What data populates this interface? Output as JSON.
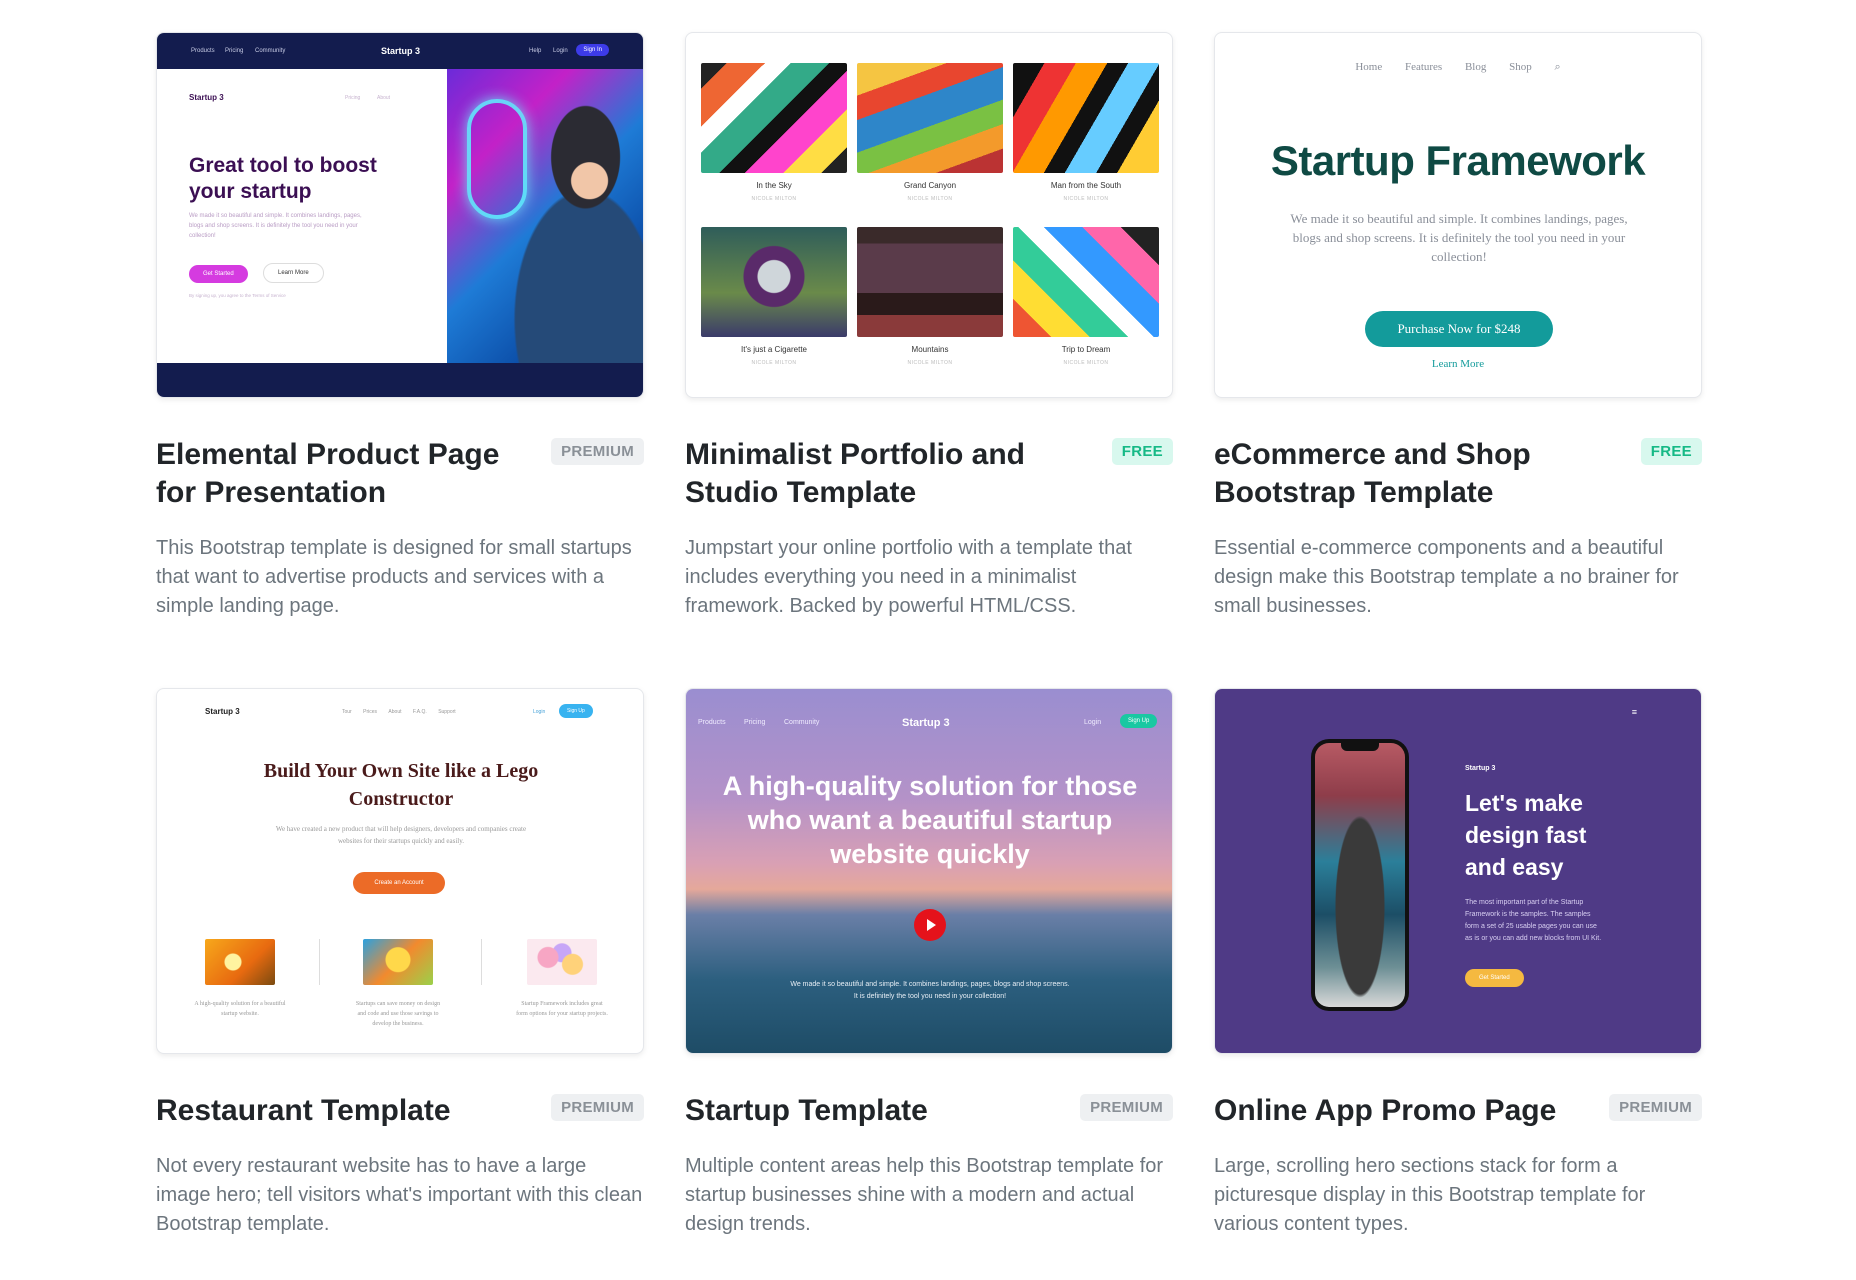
{
  "cards": [
    {
      "title": "Elemental Product Page for Presentation",
      "badge": "PREMIUM",
      "description": "This Bootstrap template is designed for small startups that want to advertise products and services with a simple landing page.",
      "thumb": {
        "nav": [
          "Products",
          "Pricing",
          "Community"
        ],
        "brand": "Startup 3",
        "nav_right": [
          "Help",
          "Login"
        ],
        "sign_in": "Sign In",
        "inner_brand": "Startup 3",
        "inner_nav": [
          "Pricing",
          "About"
        ],
        "headline": "Great tool to boost your startup",
        "body": "We made it so beautiful and simple. It combines landings, pages, blogs and shop screens. It is definitely the tool you need in your collection!",
        "primary": "Get Started",
        "secondary": "Learn More",
        "legal": "By signing up, you agree to the Terms of Service"
      }
    },
    {
      "title": "Minimalist Portfolio and Studio Template",
      "badge": "FREE",
      "description": "Jumpstart your online portfolio with a template that includes everything you need in a minimalist framework. Backed by powerful HTML/CSS.",
      "thumb": {
        "items": [
          {
            "caption": "In the Sky",
            "author": "NICOLE MILTON"
          },
          {
            "caption": "Grand Canyon",
            "author": "NICOLE MILTON"
          },
          {
            "caption": "Man from the South",
            "author": "NICOLE MILTON"
          },
          {
            "caption": "It's just a Cigarette",
            "author": "NICOLE MILTON"
          },
          {
            "caption": "Mountains",
            "author": "NICOLE MILTON"
          },
          {
            "caption": "Trip to Dream",
            "author": "NICOLE MILTON"
          }
        ]
      }
    },
    {
      "title": "eCommerce and Shop Bootstrap Template",
      "badge": "FREE",
      "description": "Essential e-commerce components and a beautiful design make this Bootstrap template a no brainer for small businesses.",
      "thumb": {
        "nav": [
          "Home",
          "Features",
          "Blog",
          "Shop"
        ],
        "headline": "Startup Framework",
        "body": "We made it so beautiful and simple. It combines landings, pages, blogs and shop screens. It is definitely the tool you need in your collection!",
        "button": "Purchase Now for $248",
        "link": "Learn More"
      }
    },
    {
      "title": "Restaurant Template",
      "badge": "PREMIUM",
      "description": "Not every restaurant website has to have a large image hero; tell visitors what's important with this clean Bootstrap template.",
      "thumb": {
        "brand": "Startup 3",
        "nav": [
          "Tour",
          "Prices",
          "About",
          "F.A.Q.",
          "Support"
        ],
        "login": "Login",
        "sign_up": "Sign Up",
        "headline": "Build Your Own Site like a Lego Constructor",
        "body": "We have created a new product that will help designers, developers and companies create websites for their startups quickly and easily.",
        "button": "Create an Account",
        "features": [
          "A high-quality solution for a beautiful startup website.",
          "Startups can save money on design and code and use those savings to develop the business.",
          "Startup Framework includes great form options for your startup projects."
        ]
      }
    },
    {
      "title": "Startup Template",
      "badge": "PREMIUM",
      "description": "Multiple content areas help this Bootstrap template for startup businesses shine with a modern and actual design trends.",
      "thumb": {
        "nav": [
          "Products",
          "Pricing",
          "Community"
        ],
        "brand": "Startup 3",
        "login": "Login",
        "sign_up": "Sign Up",
        "headline": "A high-quality solution for those who want a beautiful startup website quickly",
        "body": "We made it so beautiful and simple. It combines landings, pages, blogs and shop screens. It is definitely the tool you need in your collection!"
      }
    },
    {
      "title": "Online App Promo Page",
      "badge": "PREMIUM",
      "description": "Large, scrolling hero sections stack for form a picturesque display in this Bootstrap template for various content types.",
      "thumb": {
        "brand": "Startup 3",
        "headline": "Let's make design fast and easy",
        "body": "The most important part of the Startup Framework is the samples. The samples form a set of 25 usable pages you can use as is or you can add new blocks from UI Kit.",
        "button": "Get Started",
        "menu_icon": "≡"
      }
    }
  ],
  "colors": {
    "premium_badge": "#8a9097",
    "free_badge": "#16b986",
    "title": "#212529",
    "description": "#6c757d"
  }
}
